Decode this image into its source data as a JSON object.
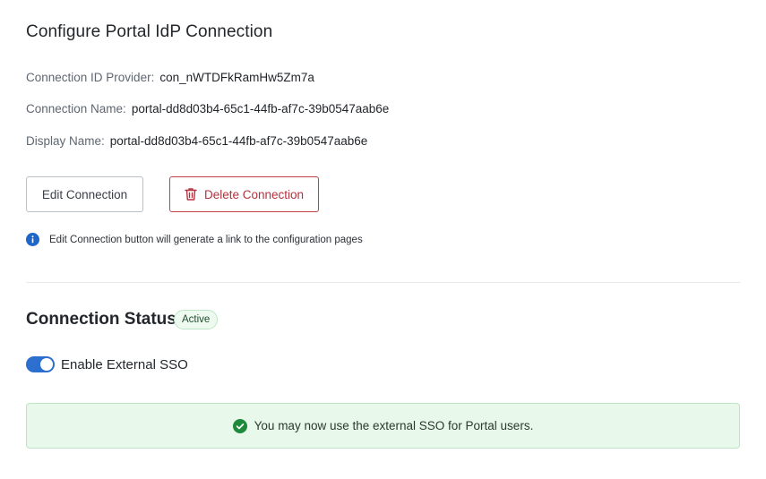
{
  "header": {
    "title": "Configure Portal IdP Connection"
  },
  "details": [
    {
      "label": "Connection ID Provider:",
      "value": "con_nWTDFkRamHw5Zm7a"
    },
    {
      "label": "Connection Name:",
      "value": "portal-dd8d03b4-65c1-44fb-af7c-39b0547aab6e"
    },
    {
      "label": "Display Name:",
      "value": "portal-dd8d03b4-65c1-44fb-af7c-39b0547aab6e"
    }
  ],
  "actions": {
    "edit_label": "Edit Connection",
    "delete_label": "Delete Connection",
    "delete_icon": "trash-icon"
  },
  "info": {
    "icon": "info-icon",
    "text": "Edit Connection button will generate a link to the configuration pages"
  },
  "status": {
    "title": "Connection Status",
    "badge": "Active"
  },
  "sso": {
    "label": "Enable External SSO",
    "enabled": true
  },
  "alert": {
    "icon": "check-circle-icon",
    "text": "You may now use the external SSO for Portal users."
  },
  "colors": {
    "accent": "#2d6fcf",
    "danger": "#b3323d",
    "success": "#1e8a3a",
    "success_bg": "#e8f8ea"
  }
}
